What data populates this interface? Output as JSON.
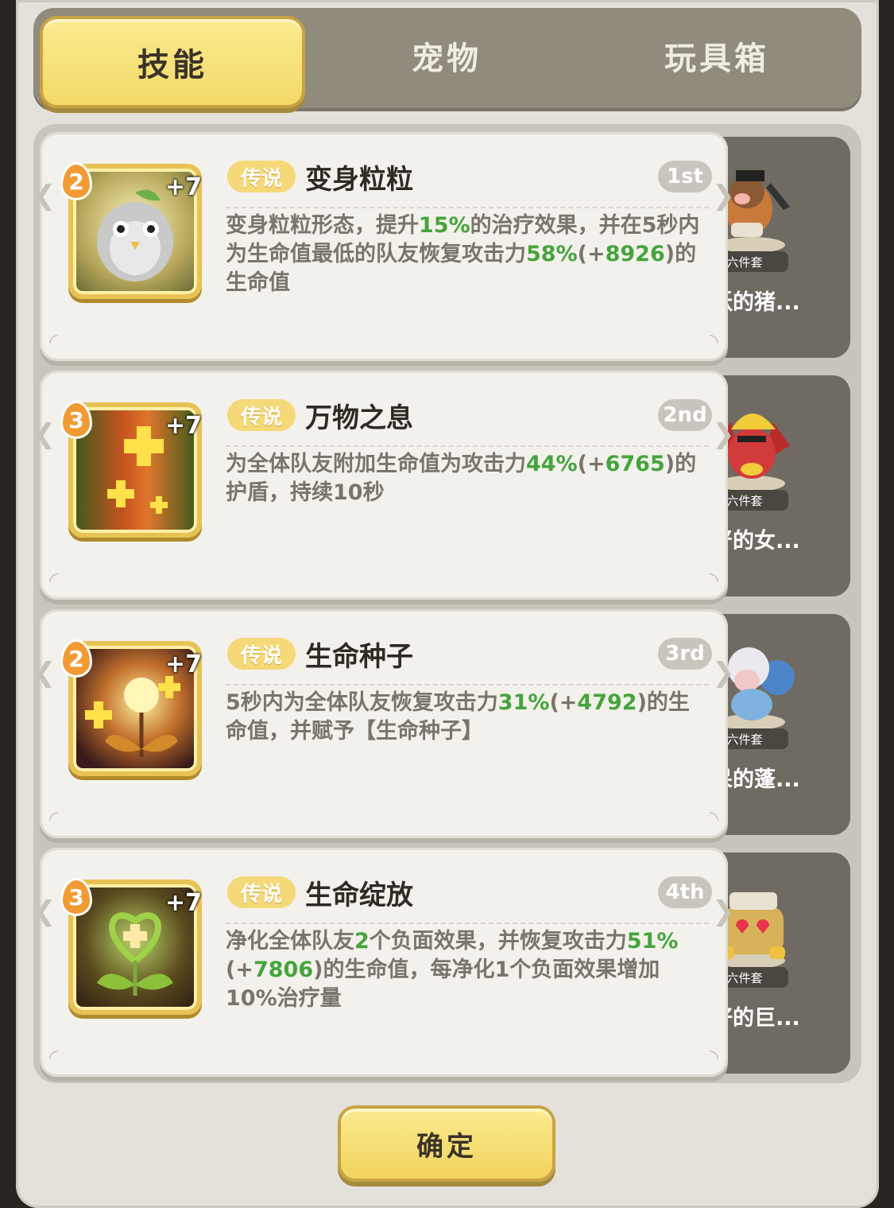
{
  "tabs": [
    {
      "label": "技能",
      "active": true
    },
    {
      "label": "宠物",
      "active": false
    },
    {
      "label": "玩具箱",
      "active": false
    }
  ],
  "skills": [
    {
      "level": "2",
      "plus": "+7",
      "rarity": "传说",
      "name": "变身粒粒",
      "rank": "1st",
      "desc": [
        "变身粒粒形态，提升",
        "15%",
        "的治疗效果，并在5秒内为生命值最低的队友恢复攻击力",
        "58%",
        "(+",
        "8926",
        ")的生命值"
      ],
      "pet": {
        "tag": "六件套",
        "name": "活跃的猪..."
      }
    },
    {
      "level": "3",
      "plus": "+7",
      "rarity": "传说",
      "name": "万物之息",
      "rank": "2nd",
      "desc": [
        "为全体队友附加生命值为攻击力",
        "44%",
        "(+",
        "6765",
        ")的护盾，持续10秒"
      ],
      "pet": {
        "tag": "六件套",
        "name": "威严的女..."
      }
    },
    {
      "level": "2",
      "plus": "+7",
      "rarity": "传说",
      "name": "生命种子",
      "rank": "3rd",
      "desc": [
        "5秒内为全体队友恢复攻击力",
        "31%",
        "(+",
        "4792",
        ")的生命值，并赋予【生命种子】"
      ],
      "pet": {
        "tag": "六件套",
        "name": "发呆的蓬..."
      }
    },
    {
      "level": "3",
      "plus": "+7",
      "rarity": "传说",
      "name": "生命绽放",
      "rank": "4th",
      "desc": [
        "净化全体队友",
        "2",
        "个负面效果，并恢复攻击力",
        "51%",
        "(+",
        "7806",
        ")的生命值，每净化1个负面效果增加10%治疗量"
      ],
      "pet": {
        "tag": "六件套",
        "name": "友好的巨..."
      }
    }
  ],
  "confirm_label": "确定",
  "colors": {
    "accent_yellow": "#f3d968",
    "green_value": "#45a43c",
    "tab_bar": "#908b7c"
  }
}
